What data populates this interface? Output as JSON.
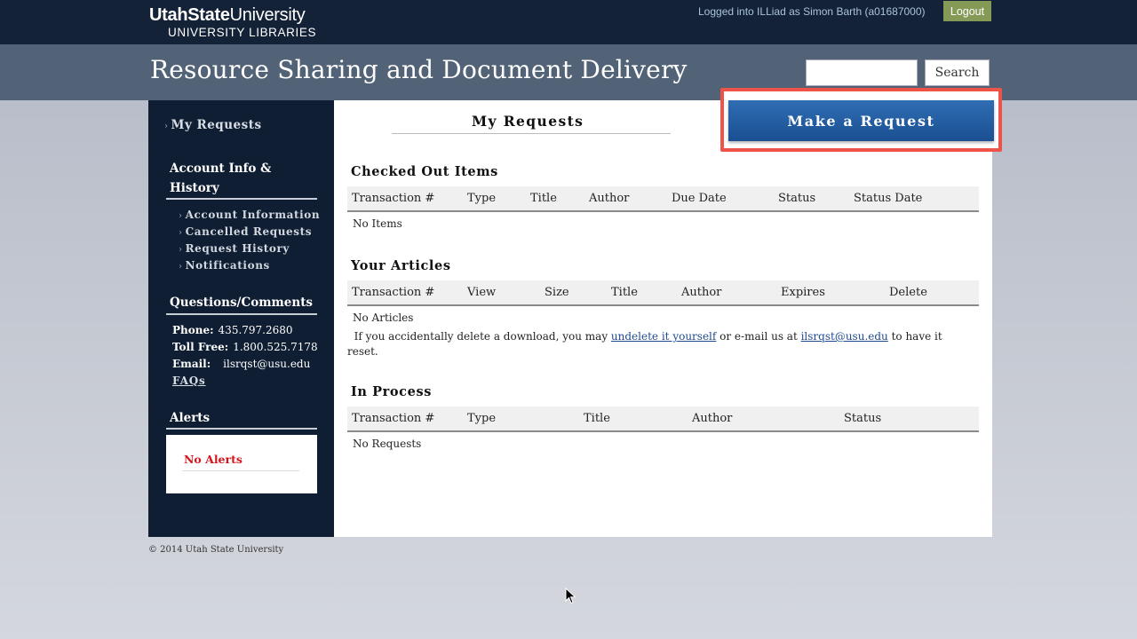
{
  "header": {
    "logo_bold": "UtahState",
    "logo_regular": "University",
    "logo_sub": "UNIVERSITY LIBRARIES",
    "login_text": "Logged into ILLiad as Simon Barth (a01687000)",
    "logout_label": "Logout"
  },
  "titlebar": {
    "title": "Resource Sharing and Document Delivery",
    "search_value": "",
    "search_label": "Search"
  },
  "sidebar": {
    "my_requests": "My Requests",
    "account_heading_line1": "Account Info &",
    "account_heading_line2": "History",
    "account_links": [
      {
        "label": "Account Information"
      },
      {
        "label": "Cancelled Requests"
      },
      {
        "label": "Request History"
      },
      {
        "label": "Notifications"
      }
    ],
    "questions_heading": "Questions/Comments",
    "phone_label": "Phone:",
    "phone": "435.797.2680",
    "tollfree_label": "Toll Free:",
    "tollfree": "1.800.525.7178",
    "email_label": "Email:",
    "email": "ilsrqst@usu.edu",
    "faqs": "FAQs",
    "alerts_heading": "Alerts",
    "no_alerts": "No Alerts"
  },
  "main": {
    "title": "My Requests",
    "make_request": "Make a Request",
    "checked_out": {
      "title": "Checked Out Items",
      "columns": [
        "Transaction #",
        "Type",
        "Title",
        "Author",
        "Due Date",
        "Status",
        "Status Date"
      ],
      "empty": "No Items"
    },
    "articles": {
      "title": "Your Articles",
      "columns": [
        "Transaction #",
        "View",
        "Size",
        "Title",
        "Author",
        "Expires",
        "Delete"
      ],
      "empty": "No Articles",
      "note_before": "If you accidentally delete a download, you may ",
      "note_link1": "undelete it yourself",
      "note_middle": " or e-mail us at ",
      "note_link2": "ilsrqst@usu.edu",
      "note_after": " to have it reset."
    },
    "in_process": {
      "title": "In Process",
      "columns": [
        "Transaction #",
        "Type",
        "Title",
        "Author",
        "Status"
      ],
      "empty": "No Requests"
    }
  },
  "footer": {
    "copyright": "© 2014 Utah State University"
  },
  "colors": {
    "top_bar": "#132236",
    "title_band": "#536377",
    "sidebar": "#0f1e33",
    "make_request_button": "#1f5aa0",
    "highlight_border": "#ee5349",
    "logout_button": "#869a58",
    "alert_text": "#d6141e"
  }
}
